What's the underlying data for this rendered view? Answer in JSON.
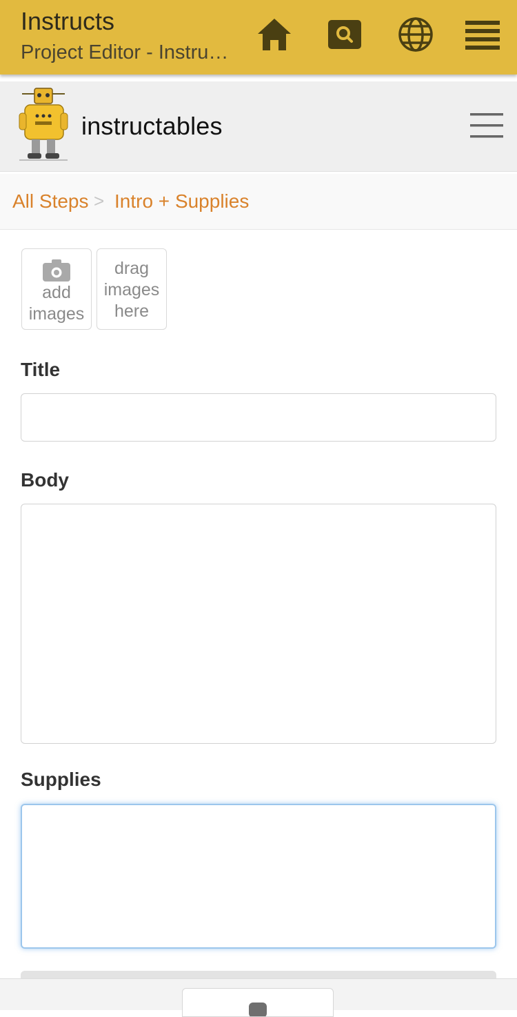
{
  "appbar": {
    "title": "Instructs",
    "subtitle": "Project Editor - Instru…",
    "icons": [
      "home-icon",
      "search-icon",
      "globe-icon",
      "menu-icon"
    ],
    "color": "#e2ba3f"
  },
  "header": {
    "brand": "instructables",
    "logo": "robot-logo",
    "menu_icon": "hamburger-icon"
  },
  "breadcrumb": {
    "items": [
      "All Steps",
      "Intro + Supplies"
    ],
    "separator": ">",
    "link_color": "#d9822b"
  },
  "images": {
    "add_line1": "add",
    "add_line2": "images",
    "drag_line1": "drag",
    "drag_line2": "images",
    "drag_line3": "here"
  },
  "form": {
    "title_label": "Title",
    "title_value": "",
    "body_label": "Body",
    "body_value": "",
    "supplies_label": "Supplies",
    "supplies_value": ""
  }
}
